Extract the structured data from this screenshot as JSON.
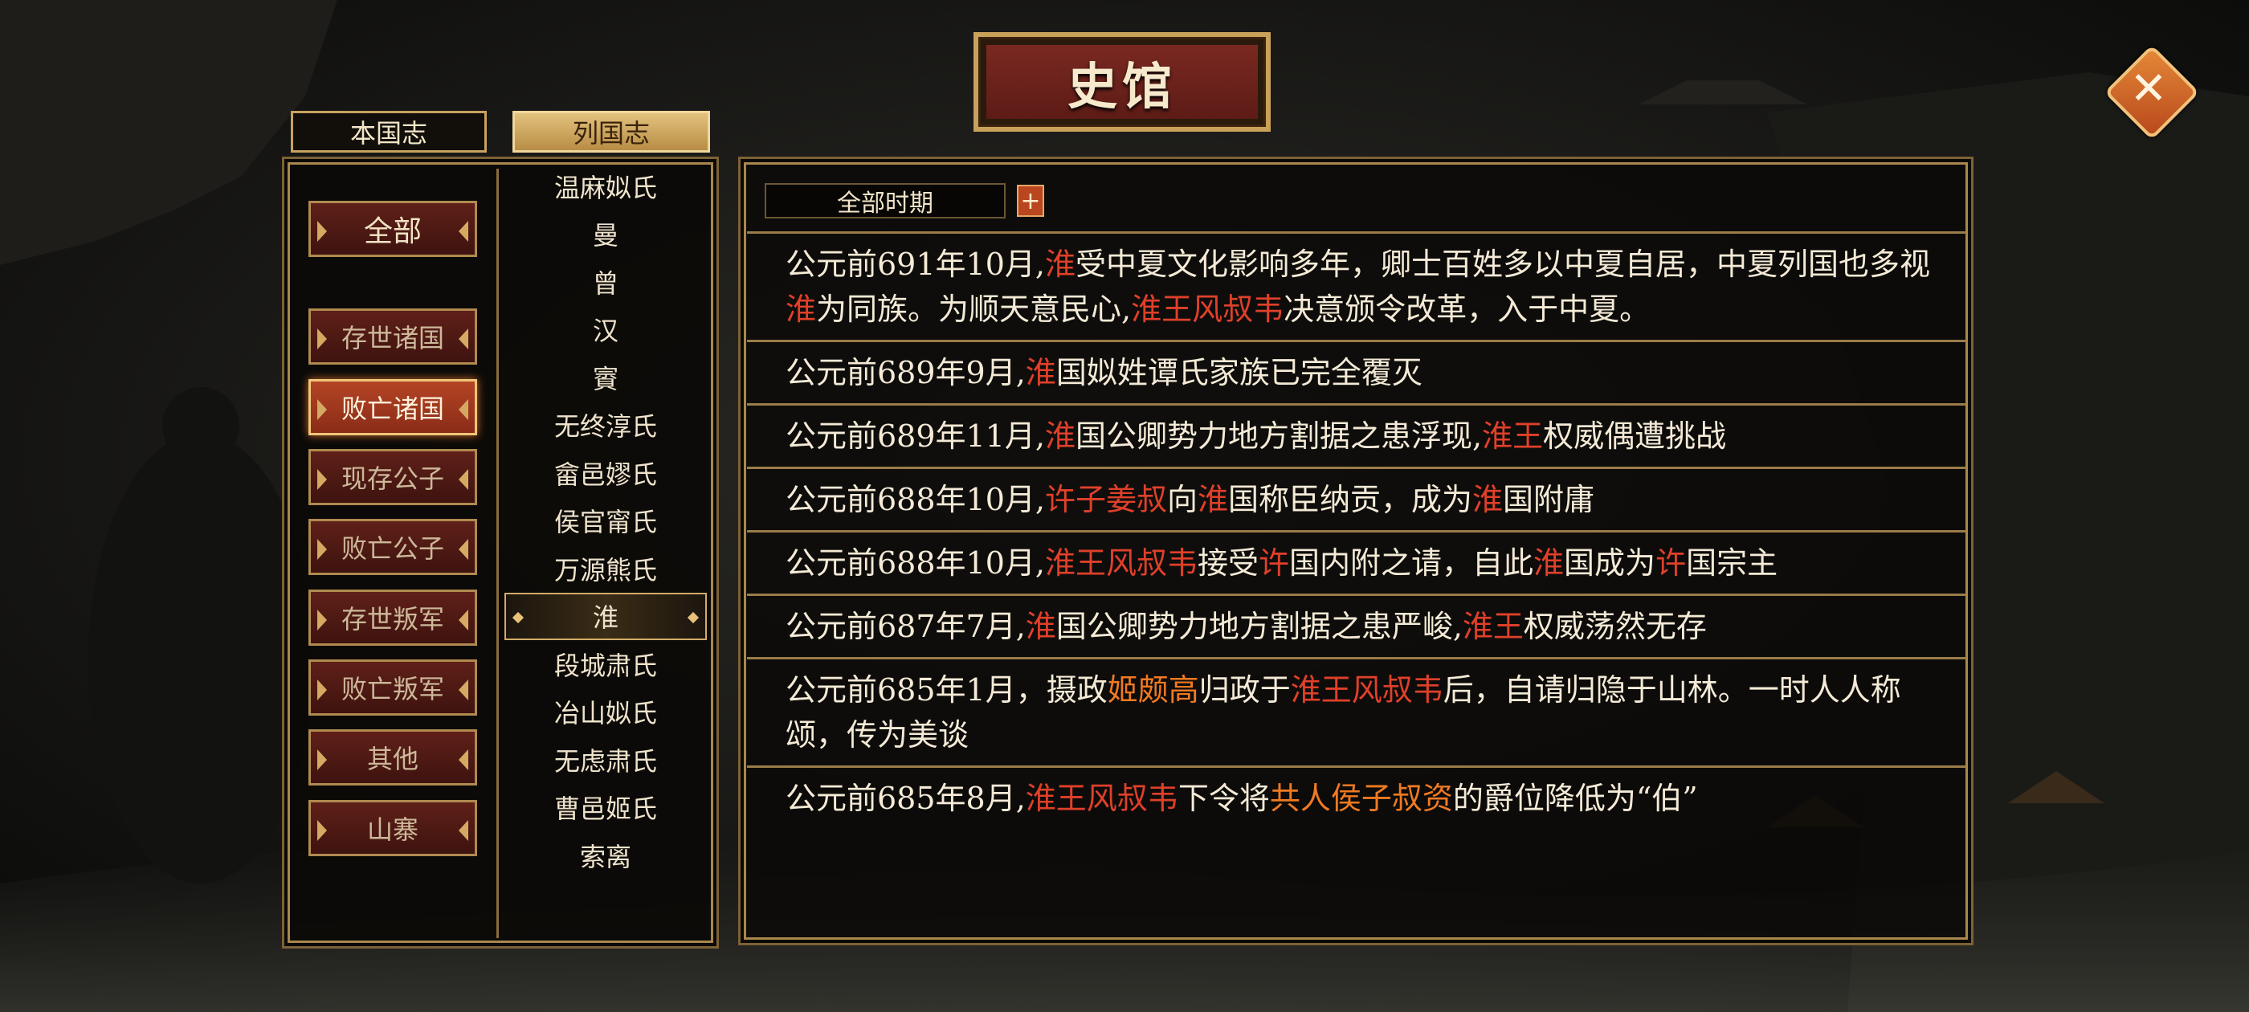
{
  "title": "史馆",
  "tabs": [
    {
      "label": "本国志",
      "active": false
    },
    {
      "label": "列国志",
      "active": true
    }
  ],
  "categories": [
    {
      "label": "全部",
      "active": false
    },
    {
      "label": "存世诸国",
      "active": false
    },
    {
      "label": "败亡诸国",
      "active": true
    },
    {
      "label": "现存公子",
      "active": false
    },
    {
      "label": "败亡公子",
      "active": false
    },
    {
      "label": "存世叛军",
      "active": false
    },
    {
      "label": "败亡叛军",
      "active": false
    },
    {
      "label": "其他",
      "active": false
    },
    {
      "label": "山寨",
      "active": false
    }
  ],
  "states": [
    "温麻姒氏",
    "曼",
    "曾",
    "汉",
    "賨",
    "无终淳氏",
    "畲邑嫪氏",
    "侯官甯氏",
    "万源熊氏",
    "淮",
    "段城肃氏",
    "冶山姒氏",
    "无虑肃氏",
    "曹邑姬氏",
    "索离"
  ],
  "selected_state": "淮",
  "filter": {
    "period_label": "全部时期",
    "plus_label": "+"
  },
  "log_entries": [
    [
      {
        "t": "公元前691年10月,",
        "c": ""
      },
      {
        "t": "淮",
        "c": "hl"
      },
      {
        "t": "受中夏文化影响多年，卿士百姓多以中夏自居，中夏列国也多视",
        "c": ""
      },
      {
        "t": "淮",
        "c": "hl"
      },
      {
        "t": "为同族。为顺天意民心,",
        "c": ""
      },
      {
        "t": "淮王风叔韦",
        "c": "hl"
      },
      {
        "t": "决意颁令改革，入于中夏。",
        "c": ""
      }
    ],
    [
      {
        "t": "公元前689年9月,",
        "c": ""
      },
      {
        "t": "淮",
        "c": "hl"
      },
      {
        "t": "国姒姓谭氏家族已完全覆灭",
        "c": ""
      }
    ],
    [
      {
        "t": "公元前689年11月,",
        "c": ""
      },
      {
        "t": "淮",
        "c": "hl"
      },
      {
        "t": "国公卿势力地方割据之患浮现,",
        "c": ""
      },
      {
        "t": "淮王",
        "c": "hl"
      },
      {
        "t": "权威偶遭挑战",
        "c": ""
      }
    ],
    [
      {
        "t": "公元前688年10月,",
        "c": ""
      },
      {
        "t": "许子姜叔",
        "c": "hl"
      },
      {
        "t": "向",
        "c": ""
      },
      {
        "t": "淮",
        "c": "hl"
      },
      {
        "t": "国称臣纳贡，成为",
        "c": ""
      },
      {
        "t": "淮",
        "c": "hl"
      },
      {
        "t": "国附庸",
        "c": ""
      }
    ],
    [
      {
        "t": "公元前688年10月,",
        "c": ""
      },
      {
        "t": "淮王风叔韦",
        "c": "hl"
      },
      {
        "t": "接受",
        "c": ""
      },
      {
        "t": "许",
        "c": "hl"
      },
      {
        "t": "国内附之请，自此",
        "c": ""
      },
      {
        "t": "淮",
        "c": "hl"
      },
      {
        "t": "国成为",
        "c": ""
      },
      {
        "t": "许",
        "c": "hl"
      },
      {
        "t": "国宗主",
        "c": ""
      }
    ],
    [
      {
        "t": "公元前687年7月,",
        "c": ""
      },
      {
        "t": "淮",
        "c": "hl"
      },
      {
        "t": "国公卿势力地方割据之患严峻,",
        "c": ""
      },
      {
        "t": "淮王",
        "c": "hl"
      },
      {
        "t": "权威荡然无存",
        "c": ""
      }
    ],
    [
      {
        "t": "公元前685年1月，摄政",
        "c": ""
      },
      {
        "t": "姬颇高",
        "c": "ho"
      },
      {
        "t": "归政于",
        "c": ""
      },
      {
        "t": "淮王风叔韦",
        "c": "hl"
      },
      {
        "t": "后，自请归隐于山林。一时人人称颂，传为美谈",
        "c": ""
      }
    ],
    [
      {
        "t": "公元前685年8月,",
        "c": ""
      },
      {
        "t": "淮王风叔韦",
        "c": "hl"
      },
      {
        "t": "下令将",
        "c": ""
      },
      {
        "t": "共人侯子叔资",
        "c": "ho"
      },
      {
        "t": "的爵位降低为“伯”",
        "c": ""
      }
    ]
  ],
  "colors": {
    "highlight_red": "#e0402a",
    "highlight_orange": "#f07a22",
    "gold_border": "#a9874d",
    "text": "#f4ead6"
  },
  "icons": {
    "close": "close-x-icon"
  }
}
